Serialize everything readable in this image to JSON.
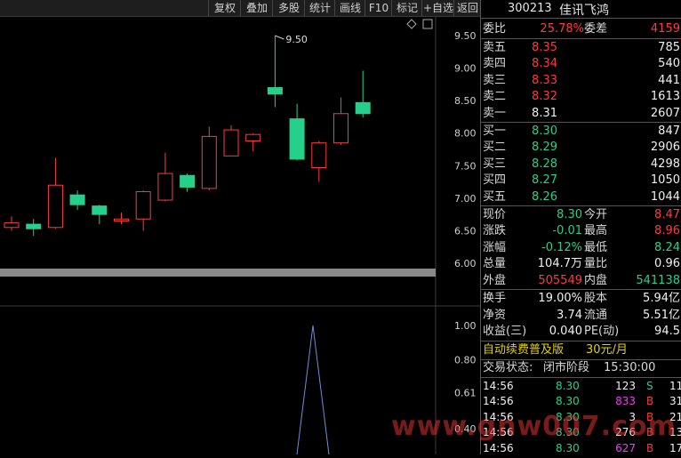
{
  "toolbar": [
    "复权",
    "叠加",
    "多股",
    "统计",
    "画线",
    "F10",
    "标记",
    "+自选",
    "返回"
  ],
  "stock": {
    "code": "300213",
    "name": "佳讯飞鸿"
  },
  "weibi": {
    "label": "委比",
    "value": "25.78%",
    "label2": "委差",
    "value2": "4159"
  },
  "asks": [
    {
      "label": "卖五",
      "price": "8.35",
      "vol": "785"
    },
    {
      "label": "卖四",
      "price": "8.34",
      "vol": "540"
    },
    {
      "label": "卖三",
      "price": "8.33",
      "vol": "441"
    },
    {
      "label": "卖二",
      "price": "8.32",
      "vol": "1613"
    },
    {
      "label": "卖一",
      "price": "8.31",
      "vol": "2607"
    }
  ],
  "bids": [
    {
      "label": "买一",
      "price": "8.30",
      "vol": "847"
    },
    {
      "label": "买二",
      "price": "8.29",
      "vol": "2906"
    },
    {
      "label": "买三",
      "price": "8.28",
      "vol": "4298"
    },
    {
      "label": "买四",
      "price": "8.27",
      "vol": "1050"
    },
    {
      "label": "买五",
      "price": "8.26",
      "vol": "1044"
    }
  ],
  "quote": [
    {
      "l": "现价",
      "v": "8.30",
      "l2": "今开",
      "v2": "8.47"
    },
    {
      "l": "涨跌",
      "v": "-0.01",
      "l2": "最高",
      "v2": "8.96"
    },
    {
      "l": "涨幅",
      "v": "-0.12%",
      "l2": "最低",
      "v2": "8.24"
    },
    {
      "l": "总量",
      "v": "104.7万",
      "l2": "量比",
      "v2": "0.96"
    },
    {
      "l": "外盘",
      "v": "505549",
      "l2": "内盘",
      "v2": "541138"
    }
  ],
  "fin": [
    {
      "l": "换手",
      "v": "19.00%",
      "l2": "股本",
      "v2": "5.94亿"
    },
    {
      "l": "净资",
      "v": "3.74",
      "l2": "流通",
      "v2": "5.51亿"
    },
    {
      "l": "收益(三)",
      "v": "0.040",
      "l2": "PE(动)",
      "v2": "94.5"
    }
  ],
  "promo": {
    "text": "自动续费普及版",
    "price": "30元/月"
  },
  "trade_status": {
    "label": "交易状态:",
    "phase": "闭市阶段",
    "time": "15:30:00"
  },
  "ticks": [
    {
      "t": "14:56",
      "p": "8.30",
      "v": "123",
      "s": "S",
      "n": "11"
    },
    {
      "t": "14:56",
      "p": "8.30",
      "v": "833",
      "s": "B",
      "n": "31"
    },
    {
      "t": "14:56",
      "p": "8.30",
      "v": "3",
      "s": "B",
      "n": "21"
    },
    {
      "t": "14:56",
      "p": "8.30",
      "v": "276",
      "s": "B",
      "n": "13"
    },
    {
      "t": "14:56",
      "p": "8.30",
      "v": "627",
      "s": "B",
      "n": "17"
    }
  ],
  "watermark": "www.gnw007.com",
  "colors": {
    "up": "#ff3b3b",
    "down": "#27d08a",
    "axis_text": "#d0d0d0"
  },
  "chart_data": [
    {
      "type": "candlestick",
      "yticks": [
        "9.50",
        "9.00",
        "8.50",
        "8.00",
        "7.50",
        "7.00",
        "6.50",
        "6.00"
      ],
      "ylim": [
        6.0,
        9.5
      ],
      "high_label": "9.50",
      "candles": [
        {
          "o": 6.55,
          "c": 6.62,
          "h": 6.72,
          "l": 6.5
        },
        {
          "o": 6.6,
          "c": 6.53,
          "h": 6.68,
          "l": 6.42
        },
        {
          "o": 6.55,
          "c": 7.2,
          "h": 7.62,
          "l": 6.53
        },
        {
          "o": 7.05,
          "c": 6.9,
          "h": 7.12,
          "l": 6.82
        },
        {
          "o": 6.88,
          "c": 6.75,
          "h": 6.9,
          "l": 6.6
        },
        {
          "o": 6.65,
          "c": 6.68,
          "h": 6.78,
          "l": 6.6
        },
        {
          "o": 6.68,
          "c": 7.1,
          "h": 7.12,
          "l": 6.5
        },
        {
          "o": 6.97,
          "c": 7.38,
          "h": 7.7,
          "l": 6.95
        },
        {
          "o": 7.35,
          "c": 7.17,
          "h": 7.38,
          "l": 7.1
        },
        {
          "o": 7.15,
          "c": 7.95,
          "h": 8.1,
          "l": 7.12
        },
        {
          "o": 7.65,
          "c": 8.05,
          "h": 8.12,
          "l": 7.65
        },
        {
          "o": 7.88,
          "c": 7.98,
          "h": 8.0,
          "l": 7.72
        },
        {
          "o": 8.7,
          "c": 8.6,
          "h": 9.5,
          "l": 8.4
        },
        {
          "o": 8.22,
          "c": 7.6,
          "h": 8.45,
          "l": 7.58
        },
        {
          "o": 7.47,
          "c": 7.85,
          "h": 7.88,
          "l": 7.25
        },
        {
          "o": 7.85,
          "c": 8.3,
          "h": 8.55,
          "l": 7.82
        },
        {
          "o": 8.47,
          "c": 8.3,
          "h": 8.96,
          "l": 8.24
        }
      ]
    },
    {
      "type": "line",
      "yticks": [
        "1.00",
        "0.80",
        "0.61",
        "0.40"
      ],
      "ylim": [
        0.4,
        1.0
      ],
      "x": [
        0,
        1,
        2
      ],
      "values": [
        0.0,
        1.0,
        0.0
      ]
    }
  ]
}
